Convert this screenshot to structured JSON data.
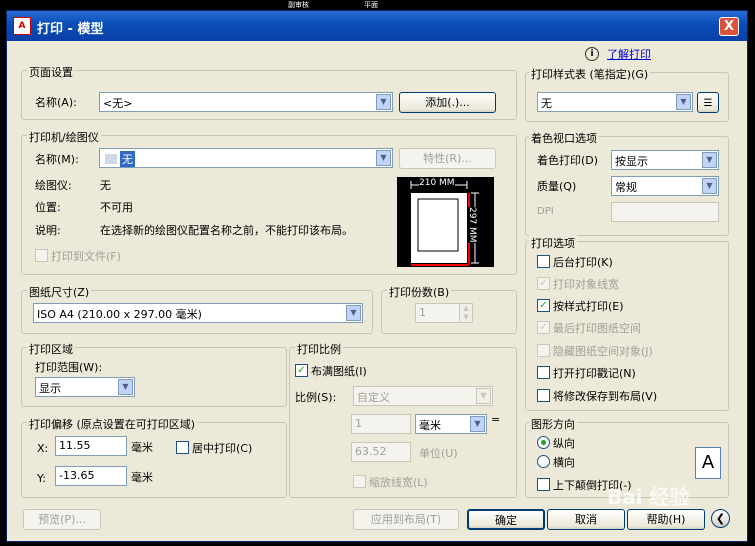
{
  "background": {
    "top_label_1": "副审核",
    "top_label_2": "平面"
  },
  "window": {
    "title": "打印 - 模型",
    "app_icon": "acad-icon",
    "close": "X"
  },
  "help": {
    "info_icon": "i",
    "link": "了解打印"
  },
  "page_setup": {
    "title": "页面设置",
    "name_label": "名称(A):",
    "name_value": "<无>",
    "add_button": "添加(.)..."
  },
  "printer": {
    "title": "打印机/绘图仪",
    "name_label": "名称(M):",
    "name_value": "无",
    "properties_button": "特性(R)...",
    "plotter_label": "绘图仪:",
    "plotter_value": "无",
    "location_label": "位置:",
    "location_value": "不可用",
    "description_label": "说明:",
    "description_value": "在选择新的绘图仪配置名称之前，不能打印该布局。",
    "print_to_file": "打印到文件(F)",
    "preview_width": "210 MM",
    "preview_height": "297 MM"
  },
  "paper_size": {
    "title": "图纸尺寸(Z)",
    "value": "ISO A4 (210.00 x 297.00 毫米)"
  },
  "copies": {
    "title": "打印份数(B)",
    "value": "1"
  },
  "plot_area": {
    "title": "打印区域",
    "range_label": "打印范围(W):",
    "range_value": "显示"
  },
  "plot_offset": {
    "title": "打印偏移 (原点设置在可打印区域)",
    "x_label": "X:",
    "x_value": "11.55",
    "x_unit": "毫米",
    "y_label": "Y:",
    "y_value": "-13.65",
    "y_unit": "毫米",
    "center": "居中打印(C)"
  },
  "plot_scale": {
    "title": "打印比例",
    "fit": "布满图纸(I)",
    "scale_label": "比例(S):",
    "scale_value": "自定义",
    "value1": "1",
    "unit": "毫米",
    "equals": "=",
    "value2": "63.52",
    "unit_label": "单位(U)",
    "lineweights": "缩放线宽(L)"
  },
  "plot_style_table": {
    "title": "打印样式表 (笔指定)(G)",
    "value": "无"
  },
  "shaded_viewport": {
    "title": "着色视口选项",
    "shade_label": "着色打印(D)",
    "shade_value": "按显示",
    "quality_label": "质量(Q)",
    "quality_value": "常规",
    "dpi_label": "DPI"
  },
  "plot_options": {
    "title": "打印选项",
    "items": [
      {
        "label": "后台打印(K)",
        "checked": false,
        "disabled": false
      },
      {
        "label": "打印对象线宽",
        "checked": true,
        "disabled": true
      },
      {
        "label": "按样式打印(E)",
        "checked": true,
        "disabled": false
      },
      {
        "label": "最后打印图纸空间",
        "checked": true,
        "disabled": true
      },
      {
        "label": "隐藏图纸空间对象(J)",
        "checked": false,
        "disabled": true
      },
      {
        "label": "打开打印戳记(N)",
        "checked": false,
        "disabled": false
      },
      {
        "label": "将修改保存到布局(V)",
        "checked": false,
        "disabled": false
      }
    ]
  },
  "orientation": {
    "title": "图形方向",
    "portrait": "纵向",
    "landscape": "横向",
    "upside_down": "上下颠倒打印(-)",
    "icon_letter": "A"
  },
  "buttons": {
    "preview": "预览(P)...",
    "apply": "应用到布局(T)",
    "ok": "确定",
    "cancel": "取消",
    "help": "帮助(H)"
  },
  "watermark": "Bai 经验"
}
